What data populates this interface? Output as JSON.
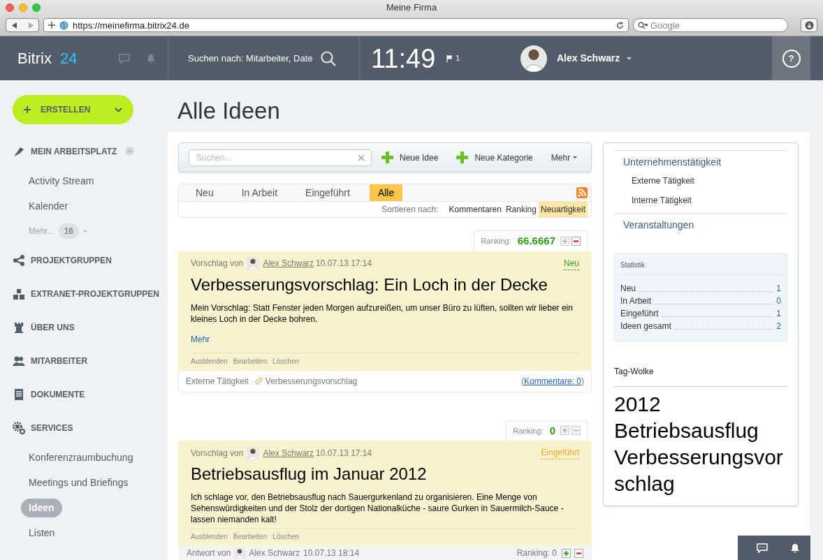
{
  "window": {
    "title": "Meine Firma",
    "url": "https://meinefirma.bitrix24.de",
    "search_placeholder": "Google"
  },
  "header": {
    "logo": "Bitrix",
    "logo_number": "24",
    "search_placeholder": "Suchen nach: Mitarbeiter, Date",
    "time": "11:49",
    "flags": "1",
    "user": "Alex Schwarz",
    "help": "?"
  },
  "sidebar": {
    "create_button": "ERSTELLEN",
    "items": [
      {
        "kind": "section",
        "label": "MEIN ARBEITSPLATZ",
        "settings": true
      },
      {
        "kind": "item",
        "label": "Activity Stream",
        "selected": false
      },
      {
        "kind": "item",
        "label": "Kalender",
        "selected": false
      },
      {
        "kind": "more",
        "label": "Mehr...",
        "count": "16"
      },
      {
        "kind": "section",
        "label": "PROJEKTGRUPPEN",
        "settings": false
      },
      {
        "kind": "section",
        "label": "EXTRANET-PROJEKTGRUPPEN",
        "settings": false
      },
      {
        "kind": "section",
        "label": "ÜBER UNS",
        "settings": false
      },
      {
        "kind": "section",
        "label": "MITARBEITER",
        "settings": false
      },
      {
        "kind": "section",
        "label": "DOKUMENTE",
        "settings": false
      },
      {
        "kind": "section",
        "label": "SERVICES",
        "settings": false
      },
      {
        "kind": "item",
        "label": "Konferenzraumbuchung",
        "selected": false
      },
      {
        "kind": "item",
        "label": "Meetings und Briefings",
        "selected": false
      },
      {
        "kind": "item",
        "label": "Ideen",
        "selected": true
      },
      {
        "kind": "item",
        "label": "Listen",
        "selected": false
      }
    ]
  },
  "page_title": "Alle Ideen",
  "toolbar": {
    "search_placeholder": "Suchen...",
    "buttons": [
      "Neue Idee",
      "Neue Kategorie"
    ],
    "more": "Mehr"
  },
  "tabs": [
    {
      "label": "Neu",
      "selected": false
    },
    {
      "label": "In Arbeit",
      "selected": false
    },
    {
      "label": "Eingeführt",
      "selected": false
    },
    {
      "label": "Alle",
      "selected": true
    }
  ],
  "sort": {
    "label": "Sortieren nach:",
    "options": [
      {
        "label": "Kommentaren",
        "selected": false
      },
      {
        "label": "Ranking",
        "selected": false
      },
      {
        "label": "Neuartigkeit",
        "selected": true
      }
    ]
  },
  "ideas": [
    {
      "ranking_label": "Ranking:",
      "ranking": "66.6667",
      "plus_active": false,
      "minus_active": true,
      "by": "Vorschlag von",
      "author": "Alex Schwarz",
      "date": "10.07.13 17:14",
      "status": {
        "label": "Neu",
        "color": "#3a9a1a"
      },
      "title": "Verbesserungsvorschlag: Ein Loch in der Decke",
      "text": "Mein Vorschlag: Statt Fenster jeden Morgen aufzureißen, um unser Büro zu lüften, sollten wir lieber ein kleines Loch in der Decke bohren.",
      "more": "Mehr",
      "actions": [
        "Ausblenden",
        "Bearbeiten",
        "Löschen"
      ],
      "category": "Externe Tätigkeit",
      "tag": "Verbesserungsvorschlag",
      "comments_open": "(",
      "comments": "Kommentare: 0",
      "comments_close": ")"
    },
    {
      "ranking_label": "Ranking:",
      "ranking": "0",
      "plus_active": false,
      "minus_active": false,
      "by": "Vorschlag von",
      "author": "Alex Schwarz",
      "date": "10.07.13 17:14",
      "status": {
        "label": "Eingeführt",
        "color": "#f0a818"
      },
      "title": "Betriebsausflug im Januar 2012",
      "text": "Ich schlage vor, den Betriebsausflug nach Sauergurkenland zu organisieren. Eine Menge von Sehenswürdigkeiten und der Stolz der dortigen Nationalküche - saure Gurken in Sauermilch-Sauce - lassen niemanden kalt!",
      "actions": [
        "Ausblenden",
        "Bearbeiten",
        "Löschen"
      ]
    }
  ],
  "answer": {
    "by": "Antwort von",
    "author": "Alex Schwarz",
    "date": "10.07.13 18:14",
    "ranking": "Ranking: 0",
    "plus_active": true,
    "minus_active": true
  },
  "categories": [
    {
      "label": "Unternehmenstätigkeit",
      "children": [
        {
          "label": "Externe Tätigkeit"
        },
        {
          "label": "Interne Tätigkeit"
        }
      ]
    },
    {
      "label": "Veranstaltungen"
    }
  ],
  "statistics": {
    "title": "Statistik",
    "rows": [
      {
        "label": "Neu",
        "value": "1"
      },
      {
        "label": "In Arbeit",
        "value": "0"
      },
      {
        "label": "Eingeführt",
        "value": "1"
      },
      {
        "label": "Ideen gesamt",
        "value": "2"
      }
    ]
  },
  "tag_cloud": {
    "title": "Tag-Wolke",
    "tags": [
      "2012",
      "Betriebsausflug",
      "Verbesserungsvorschlag"
    ]
  }
}
